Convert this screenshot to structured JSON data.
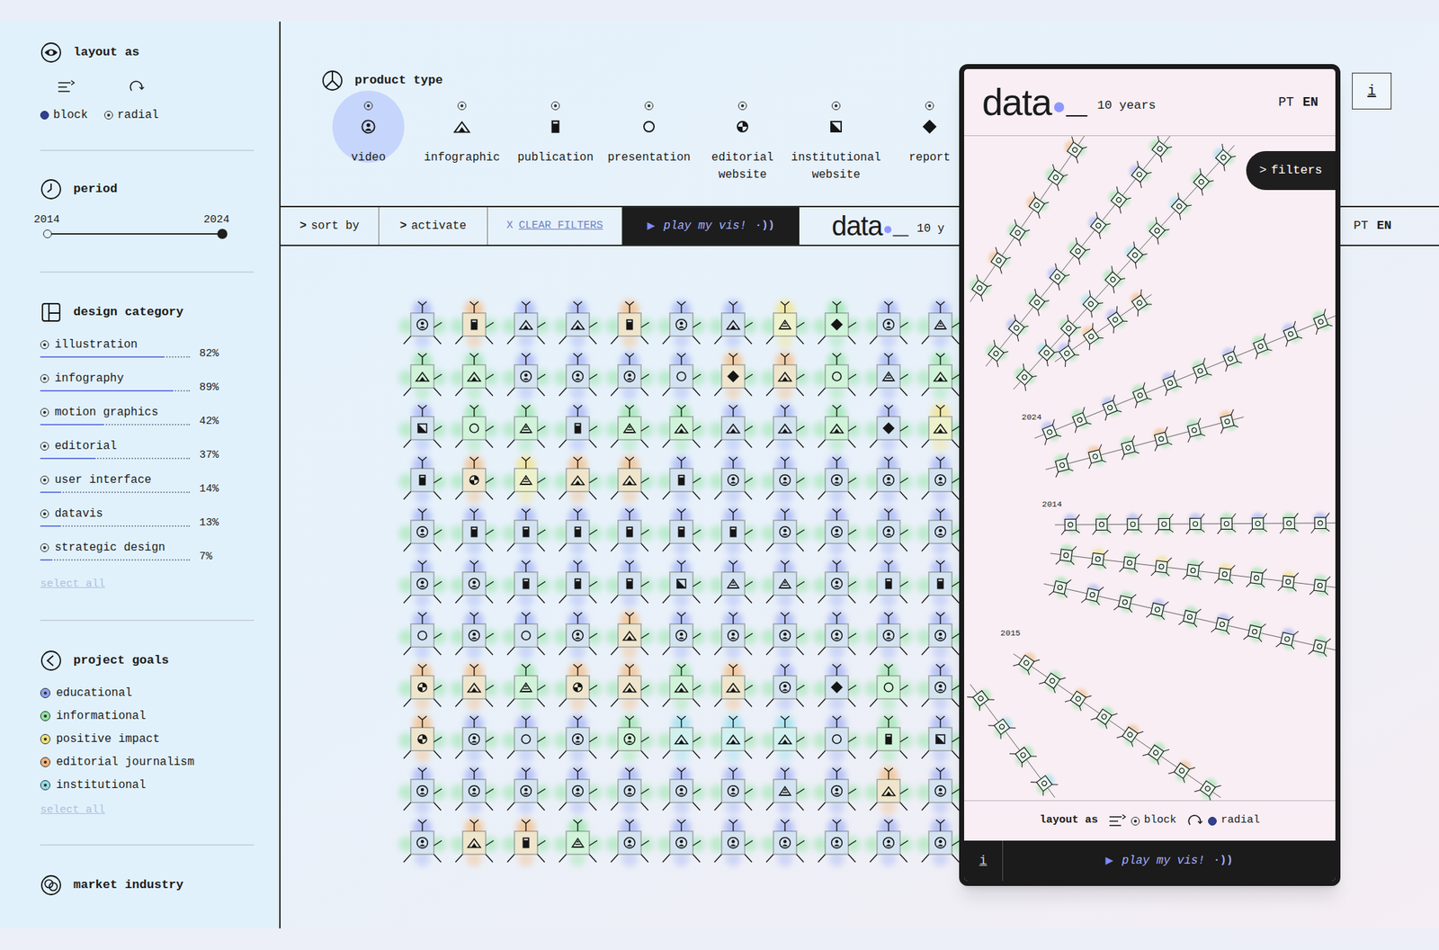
{
  "sidebar": {
    "layout": {
      "title": "layout as",
      "options": [
        {
          "label": "block",
          "selected": true
        },
        {
          "label": "radial",
          "selected": false
        }
      ]
    },
    "period": {
      "title": "period",
      "from": "2014",
      "to": "2024",
      "start_level": 0,
      "end_level": 1
    },
    "design_category": {
      "title": "design category",
      "items": [
        {
          "label": "illustration",
          "percent": "82%",
          "level": 0.82,
          "selected": false
        },
        {
          "label": "infography",
          "percent": "89%",
          "level": 0.89,
          "selected": false
        },
        {
          "label": "motion graphics",
          "percent": "42%",
          "level": 0.42,
          "selected": false
        },
        {
          "label": "editorial",
          "percent": "37%",
          "level": 0.37,
          "selected": false
        },
        {
          "label": "user interface",
          "percent": "14%",
          "level": 0.14,
          "selected": false
        },
        {
          "label": "datavis",
          "percent": "13%",
          "level": 0.13,
          "selected": false
        },
        {
          "label": "strategic design",
          "percent": "7%",
          "level": 0.07,
          "selected": false
        }
      ],
      "select_all": "select all"
    },
    "project_goals": {
      "title": "project goals",
      "items": [
        {
          "label": "educational",
          "color": "#8fa3f0"
        },
        {
          "label": "informational",
          "color": "#8fe3a0"
        },
        {
          "label": "positive impact",
          "color": "#f2e07c"
        },
        {
          "label": "editorial journalism",
          "color": "#f3b27c"
        },
        {
          "label": "institutional",
          "color": "#8edfea"
        }
      ],
      "select_all": "select all"
    },
    "market_industry": {
      "title": "market industry"
    }
  },
  "product_type": {
    "title": "product type",
    "items": [
      {
        "label": "video",
        "kind": "video",
        "selected": true
      },
      {
        "label": "infographic",
        "kind": "infographic",
        "selected": false
      },
      {
        "label": "publication",
        "kind": "publication",
        "selected": false
      },
      {
        "label": "presentation",
        "kind": "presentation",
        "selected": false
      },
      {
        "label": "editorial website",
        "kind": "editorial",
        "selected": false
      },
      {
        "label": "institutional website",
        "kind": "institutional",
        "selected": false
      },
      {
        "label": "report",
        "kind": "report",
        "selected": false
      }
    ]
  },
  "info": "i",
  "toolbar": {
    "sort_by": {
      "icon": ">",
      "label": "sort by"
    },
    "activate": {
      "icon": ">",
      "label": "activate"
    },
    "clear_filters": {
      "icon": "X",
      "label": "CLEAR FILTERS"
    },
    "play": {
      "icon": "▶",
      "label": "play my vis!",
      "sound": "·))"
    },
    "logo": {
      "word": "data",
      "cursor": "_",
      "tagline": "10 y"
    },
    "languages": [
      {
        "label": "PT",
        "selected": false
      },
      {
        "label": "EN",
        "selected": true
      }
    ]
  },
  "grid": {
    "rows": [
      [
        {
          "kind": "video",
          "color": "#a9b7f5"
        },
        {
          "kind": "publication",
          "color": "#f3bf8c"
        },
        {
          "kind": "infographic",
          "color": "#a9b7f5"
        },
        {
          "kind": "infographic",
          "color": "#a9b7f5"
        },
        {
          "kind": "publication",
          "color": "#f3bf8c"
        },
        {
          "kind": "video",
          "color": "#a9b7f5"
        },
        {
          "kind": "infographic",
          "color": "#a9b7f5"
        },
        {
          "kind": "other",
          "color": "#f1e38c"
        },
        {
          "kind": "report",
          "color": "#9fe6b0"
        },
        {
          "kind": "video",
          "color": "#a9b7f5"
        },
        {
          "kind": "other",
          "color": "#a9b7f5"
        }
      ],
      [
        {
          "kind": "infographic",
          "color": "#9fe6b0"
        },
        {
          "kind": "infographic",
          "color": "#9fe6b0"
        },
        {
          "kind": "video",
          "color": "#a9b7f5"
        },
        {
          "kind": "video",
          "color": "#a9b7f5"
        },
        {
          "kind": "video",
          "color": "#a9b7f5"
        },
        {
          "kind": "presentation",
          "color": "#a9b7f5"
        },
        {
          "kind": "report",
          "color": "#f3bf8c"
        },
        {
          "kind": "infographic",
          "color": "#f3bf8c"
        },
        {
          "kind": "presentation",
          "color": "#9fe6b0"
        },
        {
          "kind": "other",
          "color": "#a9b7f5"
        },
        {
          "kind": "infographic",
          "color": "#9fe6b0"
        }
      ],
      [
        {
          "kind": "institutional",
          "color": "#a9b7f5"
        },
        {
          "kind": "presentation",
          "color": "#9fe6b0"
        },
        {
          "kind": "other",
          "color": "#9fe6b0"
        },
        {
          "kind": "publication",
          "color": "#a9b7f5"
        },
        {
          "kind": "other",
          "color": "#9fe6b0"
        },
        {
          "kind": "infographic",
          "color": "#9fe6b0"
        },
        {
          "kind": "infographic",
          "color": "#a9b7f5"
        },
        {
          "kind": "infographic",
          "color": "#a9b7f5"
        },
        {
          "kind": "infographic",
          "color": "#9fe6b0"
        },
        {
          "kind": "report",
          "color": "#a9b7f5"
        },
        {
          "kind": "infographic",
          "color": "#f1e38c"
        }
      ],
      [
        {
          "kind": "publication",
          "color": "#a9b7f5"
        },
        {
          "kind": "editorial",
          "color": "#f3bf8c"
        },
        {
          "kind": "other",
          "color": "#f1e38c"
        },
        {
          "kind": "infographic",
          "color": "#f3bf8c"
        },
        {
          "kind": "infographic",
          "color": "#f3bf8c"
        },
        {
          "kind": "publication",
          "color": "#a9b7f5"
        },
        {
          "kind": "video",
          "color": "#a9b7f5"
        },
        {
          "kind": "video",
          "color": "#a9b7f5"
        },
        {
          "kind": "video",
          "color": "#a9b7f5"
        },
        {
          "kind": "video",
          "color": "#a9b7f5"
        },
        {
          "kind": "video",
          "color": "#a9b7f5"
        }
      ],
      [
        {
          "kind": "video",
          "color": "#a9b7f5"
        },
        {
          "kind": "publication",
          "color": "#a9b7f5"
        },
        {
          "kind": "publication",
          "color": "#a9b7f5"
        },
        {
          "kind": "publication",
          "color": "#a9b7f5"
        },
        {
          "kind": "publication",
          "color": "#a9b7f5"
        },
        {
          "kind": "publication",
          "color": "#a9b7f5"
        },
        {
          "kind": "publication",
          "color": "#a9b7f5"
        },
        {
          "kind": "video",
          "color": "#a9b7f5"
        },
        {
          "kind": "video",
          "color": "#a9b7f5"
        },
        {
          "kind": "video",
          "color": "#a9b7f5"
        },
        {
          "kind": "video",
          "color": "#a9b7f5"
        }
      ],
      [
        {
          "kind": "video",
          "color": "#a9b7f5"
        },
        {
          "kind": "video",
          "color": "#a9b7f5"
        },
        {
          "kind": "publication",
          "color": "#a9b7f5"
        },
        {
          "kind": "publication",
          "color": "#a9b7f5"
        },
        {
          "kind": "publication",
          "color": "#a9b7f5"
        },
        {
          "kind": "institutional",
          "color": "#a9b7f5"
        },
        {
          "kind": "other",
          "color": "#a9b7f5"
        },
        {
          "kind": "other",
          "color": "#a9b7f5"
        },
        {
          "kind": "video",
          "color": "#a9b7f5"
        },
        {
          "kind": "publication",
          "color": "#a9b7f5"
        },
        {
          "kind": "publication",
          "color": "#a9b7f5"
        }
      ],
      [
        {
          "kind": "presentation",
          "color": "#a9b7f5"
        },
        {
          "kind": "video",
          "color": "#a9b7f5"
        },
        {
          "kind": "presentation",
          "color": "#a9b7f5"
        },
        {
          "kind": "video",
          "color": "#a9b7f5"
        },
        {
          "kind": "infographic",
          "color": "#f3bf8c"
        },
        {
          "kind": "video",
          "color": "#a9b7f5"
        },
        {
          "kind": "video",
          "color": "#a9b7f5"
        },
        {
          "kind": "video",
          "color": "#a9b7f5"
        },
        {
          "kind": "video",
          "color": "#a9b7f5"
        },
        {
          "kind": "video",
          "color": "#a9b7f5"
        },
        {
          "kind": "video",
          "color": "#a9b7f5"
        }
      ],
      [
        {
          "kind": "editorial",
          "color": "#f3bf8c"
        },
        {
          "kind": "infographic",
          "color": "#f3bf8c"
        },
        {
          "kind": "other",
          "color": "#9fe6b0"
        },
        {
          "kind": "editorial",
          "color": "#f3bf8c"
        },
        {
          "kind": "infographic",
          "color": "#f3bf8c"
        },
        {
          "kind": "infographic",
          "color": "#9fe6b0"
        },
        {
          "kind": "infographic",
          "color": "#f3bf8c"
        },
        {
          "kind": "video",
          "color": "#a9b7f5"
        },
        {
          "kind": "report",
          "color": "#a9b7f5"
        },
        {
          "kind": "presentation",
          "color": "#9fe6b0"
        },
        {
          "kind": "video",
          "color": "#a9b7f5"
        }
      ],
      [
        {
          "kind": "editorial",
          "color": "#f3bf8c"
        },
        {
          "kind": "video",
          "color": "#a9b7f5"
        },
        {
          "kind": "presentation",
          "color": "#a9b7f5"
        },
        {
          "kind": "video",
          "color": "#a9b7f5"
        },
        {
          "kind": "video",
          "color": "#9fe6b0"
        },
        {
          "kind": "infographic",
          "color": "#9fe1ee"
        },
        {
          "kind": "infographic",
          "color": "#9fe1ee"
        },
        {
          "kind": "infographic",
          "color": "#9fe1ee"
        },
        {
          "kind": "presentation",
          "color": "#a9b7f5"
        },
        {
          "kind": "publication",
          "color": "#9fe6b0"
        },
        {
          "kind": "institutional",
          "color": "#a9b7f5"
        }
      ],
      [
        {
          "kind": "video",
          "color": "#a9b7f5"
        },
        {
          "kind": "video",
          "color": "#a9b7f5"
        },
        {
          "kind": "video",
          "color": "#a9b7f5"
        },
        {
          "kind": "video",
          "color": "#a9b7f5"
        },
        {
          "kind": "video",
          "color": "#a9b7f5"
        },
        {
          "kind": "video",
          "color": "#a9b7f5"
        },
        {
          "kind": "video",
          "color": "#a9b7f5"
        },
        {
          "kind": "other",
          "color": "#a9b7f5"
        },
        {
          "kind": "video",
          "color": "#a9b7f5"
        },
        {
          "kind": "infographic",
          "color": "#f3bf8c"
        },
        {
          "kind": "video",
          "color": "#a9b7f5"
        }
      ],
      [
        {
          "kind": "video",
          "color": "#a9b7f5"
        },
        {
          "kind": "infographic",
          "color": "#f3bf8c"
        },
        {
          "kind": "publication",
          "color": "#f3bf8c"
        },
        {
          "kind": "other",
          "color": "#9fe6b0"
        },
        {
          "kind": "video",
          "color": "#a9b7f5"
        },
        {
          "kind": "video",
          "color": "#a9b7f5"
        },
        {
          "kind": "video",
          "color": "#a9b7f5"
        },
        {
          "kind": "video",
          "color": "#a9b7f5"
        },
        {
          "kind": "video",
          "color": "#a9b7f5"
        },
        {
          "kind": "video",
          "color": "#a9b7f5"
        },
        {
          "kind": "video",
          "color": "#a9b7f5"
        }
      ]
    ]
  },
  "phone": {
    "logo": {
      "word": "data",
      "cursor": "_",
      "tagline": "10 years"
    },
    "languages": [
      {
        "label": "PT",
        "selected": false
      },
      {
        "label": "EN",
        "selected": true
      }
    ],
    "filters": {
      "icon": ">",
      "label": "filters"
    },
    "strands": [
      {
        "count": 6,
        "colors": [
          "#9fe6b0",
          "#f3bf8c"
        ]
      },
      {
        "count": 9,
        "colors": [
          "#9fe6b0",
          "#a9b7f5"
        ]
      },
      {
        "count": 10,
        "colors": [
          "#9fe6b0",
          "#9fe1ee"
        ]
      },
      {
        "count": 4,
        "colors": [
          "#a9b7f5",
          "#f3bf8c"
        ]
      },
      {
        "label": "2024",
        "count": 10,
        "colors": [
          "#a9b7f5",
          "#9fe6b0"
        ]
      },
      {
        "count": 6,
        "colors": [
          "#9fe6b0",
          "#f3bf8c"
        ]
      },
      {
        "label": "2014",
        "count": 9,
        "colors": [
          "#a9b7f5",
          "#9fe6b0"
        ]
      },
      {
        "count": 9,
        "colors": [
          "#9fe6b0",
          "#f1e38c"
        ]
      },
      {
        "count": 9,
        "colors": [
          "#9fe6b0",
          "#a9b7f5"
        ]
      },
      {
        "label": "2015",
        "count": 8,
        "colors": [
          "#f3bf8c",
          "#9fe6b0"
        ]
      },
      {
        "count": 4,
        "colors": [
          "#9fe6b0",
          "#9fe1ee"
        ]
      }
    ],
    "layout": {
      "title": "layout as",
      "options": [
        {
          "label": "block",
          "selected": false
        },
        {
          "label": "radial",
          "selected": true
        }
      ]
    },
    "info": "i",
    "play": {
      "icon": "▶",
      "label": "play my vis!",
      "sound": "·))"
    }
  }
}
